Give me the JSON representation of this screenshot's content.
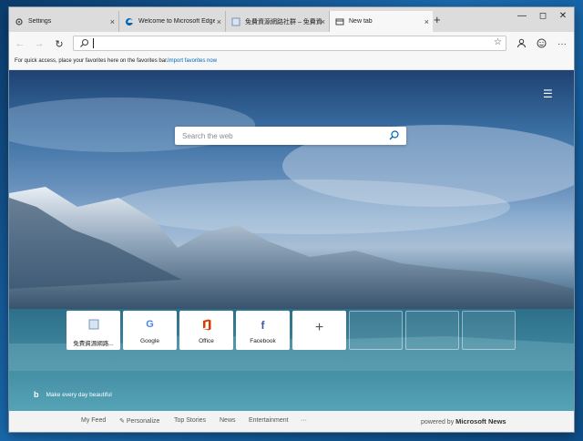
{
  "tabs": [
    {
      "title": "Settings",
      "icon": "gear-icon"
    },
    {
      "title": "Welcome to Microsoft Edge Dev",
      "icon": "edge-icon"
    },
    {
      "title": "免費資源網路社群 – 免費資源網",
      "icon": "site-icon"
    },
    {
      "title": "New tab",
      "icon": "newtab-icon",
      "active": true
    }
  ],
  "toolbar": {
    "address_value": ""
  },
  "favorites_bar": {
    "message": "For quick access, place your favorites here on the favorites bar.",
    "import_link": "Import favorites now"
  },
  "search": {
    "placeholder": "Search the web"
  },
  "tiles": [
    {
      "label": "免費資源網路...",
      "icon": "site-icon"
    },
    {
      "label": "Google",
      "icon": "google-icon"
    },
    {
      "label": "Office",
      "icon": "office-icon"
    },
    {
      "label": "Facebook",
      "icon": "facebook-icon"
    },
    {
      "label": "",
      "icon": "plus-icon"
    }
  ],
  "bing_caption": "Make every day beautiful",
  "bottom_nav": {
    "items": [
      "My Feed",
      "Personalize",
      "Top Stories",
      "News",
      "Entertainment",
      "···"
    ],
    "powered_by_prefix": "powered by",
    "powered_by_brand": "Microsoft News"
  },
  "colors": {
    "accent": "#0067b8",
    "office": "#d83b01",
    "facebook": "#3b5998"
  }
}
